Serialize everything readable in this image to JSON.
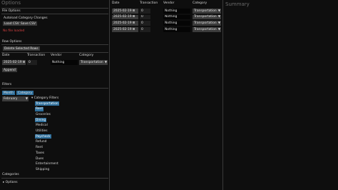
{
  "options_title": "Options",
  "summary_title": "Summary",
  "file_options": {
    "heading": "File Options",
    "autoload_label": "Autoload Category Changes",
    "load_button": "Load CSV",
    "save_button": "Save CSV",
    "status": "No file loaded"
  },
  "row_options": {
    "heading": "Row Options",
    "delete_button": "Delete Selected Rows",
    "columns": [
      "Date",
      "Transaction",
      "Vendor",
      "Category"
    ],
    "new_row": {
      "date": "2025-02-19",
      "transaction": "0",
      "vendor": "Nothing",
      "category": "Transportation"
    },
    "append_button": "Append"
  },
  "filters": {
    "heading": "Filters",
    "month_button": "Month",
    "category_button": "Category",
    "month_value": "February",
    "category_filters_label": "Category Filters",
    "categories": [
      {
        "label": "Transportation",
        "selected": true
      },
      {
        "label": "Rent",
        "selected": true
      },
      {
        "label": "Groceries",
        "selected": false
      },
      {
        "label": "Dining",
        "selected": true
      },
      {
        "label": "Medical",
        "selected": false
      },
      {
        "label": "Utilities",
        "selected": false
      },
      {
        "label": "Paycheck",
        "selected": true
      },
      {
        "label": "Refund",
        "selected": false
      },
      {
        "label": "Rent",
        "selected": false
      },
      {
        "label": "Taxes",
        "selected": false
      },
      {
        "label": "Dues",
        "selected": false
      },
      {
        "label": "Entertainment",
        "selected": false
      },
      {
        "label": "Shipping",
        "selected": false
      }
    ]
  },
  "categories_section": {
    "heading": "Categories",
    "options_label": "Options"
  },
  "table": {
    "columns": [
      "Date",
      "Transaction",
      "Vendor",
      "Category"
    ],
    "rows": [
      {
        "date": "2025-02-19",
        "transaction": "0",
        "vendor": "Nothing",
        "category": "Transportation"
      },
      {
        "date": "2025-02-19",
        "transaction": "0",
        "vendor": "Nothing",
        "category": "Transportation"
      },
      {
        "date": "2025-02-19",
        "transaction": "0",
        "vendor": "Nothing",
        "category": "Transportation"
      },
      {
        "date": "2025-02-19",
        "transaction": "0",
        "vendor": "Nothing",
        "category": "Transportation"
      }
    ]
  },
  "icons": {
    "calendar": "calendar-icon",
    "dropdown": "chevron-down-icon",
    "tree_expanded": "triangle-down-icon",
    "tree_collapsed": "triangle-right-icon"
  },
  "colors": {
    "accent": "#2f6f9b",
    "error": "#d04040",
    "background": "#0e0e0e"
  }
}
